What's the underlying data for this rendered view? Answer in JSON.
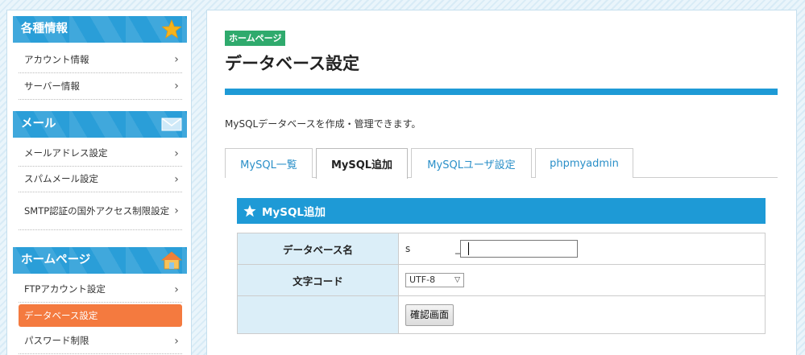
{
  "sidebar": {
    "sections": [
      {
        "title": "各種情報",
        "icon": "star-icon",
        "items": [
          {
            "label": "アカウント情報"
          },
          {
            "label": "サーバー情報"
          }
        ]
      },
      {
        "title": "メール",
        "icon": "envelope-icon",
        "items": [
          {
            "label": "メールアドレス設定"
          },
          {
            "label": "スパムメール設定"
          },
          {
            "label": "SMTP認証の国外アクセス制限設定"
          }
        ]
      },
      {
        "title": "ホームページ",
        "icon": "house-icon",
        "items": [
          {
            "label": "FTPアカウント設定"
          },
          {
            "label": "データベース設定",
            "active": true
          },
          {
            "label": "パスワード制限"
          }
        ]
      }
    ]
  },
  "main": {
    "badge": "ホームページ",
    "title": "データベース設定",
    "description": "MySQLデータベースを作成・管理できます。",
    "tabs": [
      {
        "label": "MySQL一覧"
      },
      {
        "label": "MySQL追加",
        "active": true
      },
      {
        "label": "MySQLユーザ設定"
      },
      {
        "label": "phpmyadmin"
      }
    ],
    "panel": {
      "title": "MySQL追加",
      "rows": {
        "db_name_label": "データベース名",
        "db_prefix": "s",
        "db_separator": "_",
        "db_name_value": "",
        "charset_label": "文字コード",
        "charset_value": "UTF-8",
        "confirm_button": "確認画面"
      }
    }
  },
  "colors": {
    "header_blue": "#2a9ed8",
    "active_orange": "#f47a3f",
    "badge_green": "#2faa6d",
    "star_yellow": "#f5b31b"
  }
}
